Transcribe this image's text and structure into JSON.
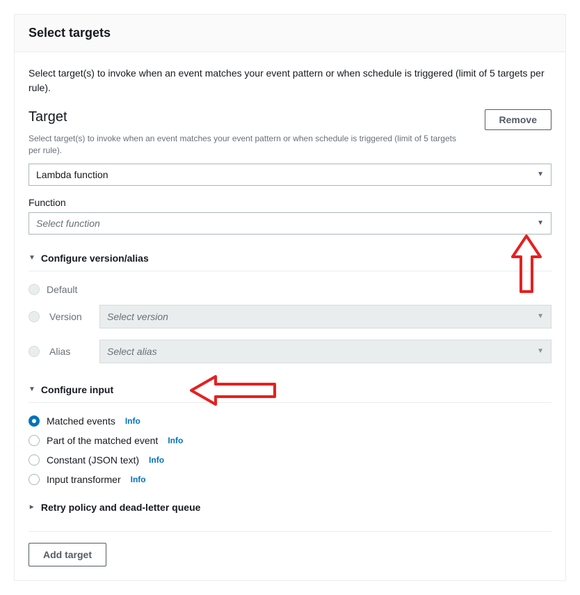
{
  "page": {
    "title": "Select targets",
    "intro": "Select target(s) to invoke when an event matches your event pattern or when schedule is triggered (limit of 5 targets per rule)."
  },
  "target": {
    "heading": "Target",
    "subtext": "Select target(s) to invoke when an event matches your event pattern or when schedule is triggered (limit of 5 targets per rule).",
    "remove_label": "Remove",
    "type_value": "Lambda function"
  },
  "function": {
    "label": "Function",
    "placeholder": "Select function"
  },
  "configure_version": {
    "title": "Configure version/alias",
    "options": {
      "default": "Default",
      "version": "Version",
      "alias": "Alias"
    },
    "version_placeholder": "Select version",
    "alias_placeholder": "Select alias"
  },
  "configure_input": {
    "title": "Configure input",
    "options": [
      {
        "label": "Matched events",
        "info": "Info",
        "selected": true
      },
      {
        "label": "Part of the matched event",
        "info": "Info",
        "selected": false
      },
      {
        "label": "Constant (JSON text)",
        "info": "Info",
        "selected": false
      },
      {
        "label": "Input transformer",
        "info": "Info",
        "selected": false
      }
    ]
  },
  "retry_section": {
    "title": "Retry policy and dead-letter queue"
  },
  "add_target_label": "Add target"
}
